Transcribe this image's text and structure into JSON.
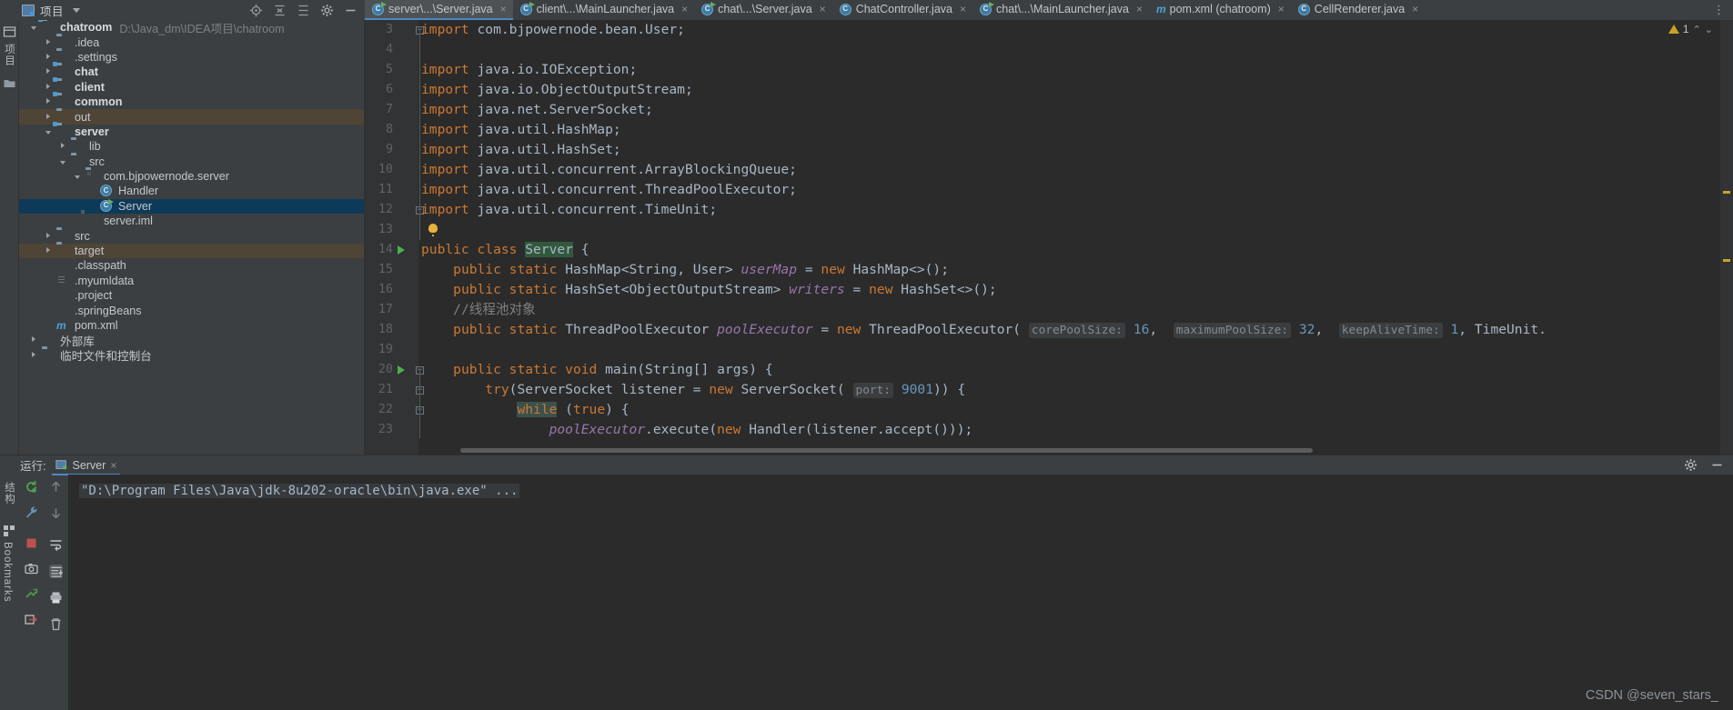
{
  "project_toolbar": {
    "title": "项目",
    "caret": "chevron-down",
    "tools": [
      "locate-icon",
      "collapse-all-icon",
      "expand-all-icon",
      "settings-icon",
      "hide-icon"
    ]
  },
  "left_strip": {
    "top_label": "项目",
    "bottom_labels": [
      "结构",
      "Bookmarks"
    ]
  },
  "tree": [
    {
      "indent": 0,
      "arrow": "down",
      "icon": "folder-module",
      "label": "chatroom",
      "bold": true,
      "path": "D:\\Java_dm\\IDEA项目\\chatroom",
      "state": "normal"
    },
    {
      "indent": 1,
      "arrow": "right",
      "icon": "folder",
      "label": ".idea",
      "bold": false,
      "path": "",
      "state": "normal"
    },
    {
      "indent": 1,
      "arrow": "right",
      "icon": "folder",
      "label": ".settings",
      "bold": false,
      "path": "",
      "state": "normal"
    },
    {
      "indent": 1,
      "arrow": "right",
      "icon": "folder-module",
      "label": "chat",
      "bold": true,
      "path": "",
      "state": "normal"
    },
    {
      "indent": 1,
      "arrow": "right",
      "icon": "folder-module",
      "label": "client",
      "bold": true,
      "path": "",
      "state": "normal"
    },
    {
      "indent": 1,
      "arrow": "right",
      "icon": "folder-module",
      "label": "common",
      "bold": true,
      "path": "",
      "state": "normal"
    },
    {
      "indent": 1,
      "arrow": "right",
      "icon": "folder-excluded",
      "label": "out",
      "bold": false,
      "path": "",
      "state": "excluded"
    },
    {
      "indent": 1,
      "arrow": "down",
      "icon": "folder-module",
      "label": "server",
      "bold": true,
      "path": "",
      "state": "normal"
    },
    {
      "indent": 2,
      "arrow": "right",
      "icon": "folder",
      "label": "lib",
      "bold": false,
      "path": "",
      "state": "normal"
    },
    {
      "indent": 2,
      "arrow": "down",
      "icon": "folder-source",
      "label": "src",
      "bold": false,
      "path": "",
      "state": "normal"
    },
    {
      "indent": 3,
      "arrow": "down",
      "icon": "folder-package",
      "label": "com.bjpowernode.server",
      "bold": false,
      "path": "",
      "state": "normal"
    },
    {
      "indent": 4,
      "arrow": "none",
      "icon": "java-class",
      "label": "Handler",
      "bold": false,
      "path": "",
      "state": "normal"
    },
    {
      "indent": 4,
      "arrow": "none",
      "icon": "java-class-runnable",
      "label": "Server",
      "bold": false,
      "path": "",
      "state": "selected"
    },
    {
      "indent": 3,
      "arrow": "none",
      "icon": "iml-file",
      "label": "server.iml",
      "bold": false,
      "path": "",
      "state": "normal"
    },
    {
      "indent": 1,
      "arrow": "right",
      "icon": "folder",
      "label": "src",
      "bold": false,
      "path": "",
      "state": "normal"
    },
    {
      "indent": 1,
      "arrow": "right",
      "icon": "folder-excluded",
      "label": "target",
      "bold": false,
      "path": "",
      "state": "excluded"
    },
    {
      "indent": 1,
      "arrow": "none",
      "icon": "xml-file",
      "label": ".classpath",
      "bold": false,
      "path": "",
      "state": "normal"
    },
    {
      "indent": 1,
      "arrow": "none",
      "icon": "uml-file",
      "label": ".myumldata",
      "bold": false,
      "path": "",
      "state": "normal"
    },
    {
      "indent": 1,
      "arrow": "none",
      "icon": "xml-file",
      "label": ".project",
      "bold": false,
      "path": "",
      "state": "normal"
    },
    {
      "indent": 1,
      "arrow": "none",
      "icon": "xml-file",
      "label": ".springBeans",
      "bold": false,
      "path": "",
      "state": "normal"
    },
    {
      "indent": 1,
      "arrow": "none",
      "icon": "maven-file",
      "label": "pom.xml",
      "bold": false,
      "path": "",
      "state": "normal"
    },
    {
      "indent": 0,
      "arrow": "right",
      "icon": "library",
      "label": "外部库",
      "bold": false,
      "path": "",
      "state": "normal"
    },
    {
      "indent": 0,
      "arrow": "right",
      "icon": "scratch",
      "label": "临时文件和控制台",
      "bold": false,
      "path": "",
      "state": "normal"
    }
  ],
  "editor_tabs": [
    {
      "label": "server\\...\\Server.java",
      "icon": "java-class-runnable",
      "active": true,
      "closable": true
    },
    {
      "label": "client\\...\\MainLauncher.java",
      "icon": "java-class-runnable",
      "active": false,
      "closable": true
    },
    {
      "label": "chat\\...\\Server.java",
      "icon": "java-class-runnable",
      "active": false,
      "closable": true
    },
    {
      "label": "ChatController.java",
      "icon": "java-class",
      "active": false,
      "closable": true
    },
    {
      "label": "chat\\...\\MainLauncher.java",
      "icon": "java-class-runnable",
      "active": false,
      "closable": true
    },
    {
      "label": "pom.xml (chatroom)",
      "icon": "maven-file",
      "active": false,
      "closable": true
    },
    {
      "label": "CellRenderer.java",
      "icon": "java-class",
      "active": false,
      "closable": true
    }
  ],
  "editor": {
    "warning_count": "1",
    "lines": [
      {
        "n": "3",
        "fold": "minus",
        "text_html": "<span class='kw'>import</span> <span class='pln'>com.bjpowernode.bean.User;</span>"
      },
      {
        "n": "4",
        "fold": "",
        "text_html": ""
      },
      {
        "n": "5",
        "fold": "",
        "text_html": "<span class='kw'>import</span> <span class='pln'>java.io.IOException;</span>"
      },
      {
        "n": "6",
        "fold": "",
        "text_html": "<span class='kw'>import</span> <span class='pln'>java.io.ObjectOutputStream;</span>"
      },
      {
        "n": "7",
        "fold": "",
        "text_html": "<span class='kw'>import</span> <span class='pln'>java.net.ServerSocket;</span>"
      },
      {
        "n": "8",
        "fold": "",
        "text_html": "<span class='kw'>import</span> <span class='pln'>java.util.HashMap;</span>"
      },
      {
        "n": "9",
        "fold": "",
        "text_html": "<span class='kw'>import</span> <span class='pln'>java.util.HashSet;</span>"
      },
      {
        "n": "10",
        "fold": "",
        "text_html": "<span class='kw'>import</span> <span class='pln'>java.util.concurrent.ArrayBlockingQueue;</span>"
      },
      {
        "n": "11",
        "fold": "",
        "text_html": "<span class='kw'>import</span> <span class='pln'>java.util.concurrent.ThreadPoolExecutor;</span>"
      },
      {
        "n": "12",
        "fold": "minus",
        "text_html": "<span class='kw'>import</span> <span class='pln'>java.util.concurrent.TimeUnit;</span>"
      },
      {
        "n": "13",
        "fold": "",
        "text_html": ""
      },
      {
        "n": "14",
        "fold": "",
        "run": true,
        "text_html": "<span class='kw'>public class</span> <span class='pln clsname'>Server</span> <span class='pln'>{</span>"
      },
      {
        "n": "15",
        "fold": "",
        "text_html": "    <span class='kw'>public static</span> <span class='pln'>HashMap&lt;String, User&gt;</span> <span class='fld'>userMap</span> <span class='pln'>=</span> <span class='kw'>new</span> <span class='pln'>HashMap&lt;&gt;();</span>"
      },
      {
        "n": "16",
        "fold": "",
        "text_html": "    <span class='kw'>public static</span> <span class='pln'>HashSet&lt;ObjectOutputStream&gt;</span> <span class='fld'>writers</span> <span class='pln'>=</span> <span class='kw'>new</span> <span class='pln'>HashSet&lt;&gt;();</span>"
      },
      {
        "n": "17",
        "fold": "",
        "text_html": "    <span class='cmt'>//线程池对象</span>"
      },
      {
        "n": "18",
        "fold": "",
        "text_html": "    <span class='kw'>public static</span> <span class='pln'>ThreadPoolExecutor</span> <span class='fld'>poolExecutor</span> <span class='pln'>=</span> <span class='kw'>new</span> <span class='pln'>ThreadPoolExecutor(</span> <span class='hint'>corePoolSize:</span> <span class='num'>16</span><span class='pln'>,</span>  <span class='hint'>maximumPoolSize:</span> <span class='num'>32</span><span class='pln'>,</span>  <span class='hint'>keepAliveTime:</span> <span class='num'>1</span><span class='pln'>,</span> <span class='pln'>TimeUnit.</span>"
      },
      {
        "n": "19",
        "fold": "",
        "text_html": ""
      },
      {
        "n": "20",
        "fold": "minus",
        "run": true,
        "text_html": "    <span class='kw'>public static void</span> <span class='pln'>main(String[] args) {</span>"
      },
      {
        "n": "21",
        "fold": "minus",
        "text_html": "        <span class='kw'>try</span><span class='pln'>(ServerSocket listener =</span> <span class='kw'>new</span> <span class='pln'>ServerSocket(</span> <span class='hint'>port:</span> <span class='num'>9001</span><span class='pln'>)) {</span>"
      },
      {
        "n": "22",
        "fold": "minus",
        "text_html": "            <span class='kw hl'>while</span> <span class='pln'>(</span><span class='kw'>true</span><span class='pln'>) {</span>"
      },
      {
        "n": "23",
        "fold": "",
        "text_html": "                <span class='fld'>poolExecutor</span><span class='pln'>.execute(</span><span class='kw'>new</span> <span class='pln'>Handler(listener.accept()));</span>"
      }
    ]
  },
  "run_panel": {
    "label": "运行:",
    "tab_label": "Server",
    "tab_close": "×",
    "header_right": [
      "settings-icon",
      "hide-icon"
    ],
    "gutter_left_icons": [
      "rerun-icon",
      "wrench-icon",
      "stop-icon",
      "camera-icon",
      "thread-dump-icon",
      "export-icon"
    ],
    "gutter_right_icons": [
      "scroll-up-icon",
      "scroll-down-icon",
      "soft-wrap-icon",
      "scroll-to-end-icon",
      "print-icon",
      "trash-icon"
    ],
    "console_text": "\"D:\\Program Files\\Java\\jdk-8u202-oracle\\bin\\java.exe\" ..."
  },
  "watermark": "CSDN @seven_stars_"
}
